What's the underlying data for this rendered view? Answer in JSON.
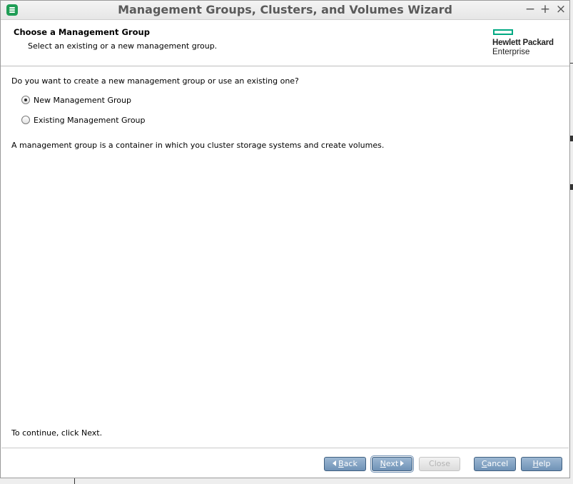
{
  "window": {
    "title": "Management Groups, Clusters, and Volumes Wizard",
    "controls": {
      "minimize": "−",
      "maximize": "+",
      "close": "×"
    }
  },
  "header": {
    "title": "Choose a Management Group",
    "subtitle": "Select an existing or a new management group.",
    "logo": {
      "name": "Hewlett Packard",
      "sub": "Enterprise",
      "brand_color": "#01a982"
    }
  },
  "body": {
    "question": "Do you want to create a new management group or use an existing one?",
    "options": [
      {
        "label": "New Management Group",
        "selected": true
      },
      {
        "label": "Existing Management Group",
        "selected": false
      }
    ],
    "description": "A management group is a container in which you cluster storage systems and create volumes.",
    "continue_hint": "To continue, click Next."
  },
  "footer": {
    "back": {
      "mnemonic": "B",
      "rest": "ack",
      "enabled": true
    },
    "next": {
      "mnemonic": "N",
      "rest": "ext",
      "enabled": true,
      "focused": true
    },
    "close": {
      "label": "Close",
      "enabled": false
    },
    "cancel": {
      "mnemonic": "C",
      "rest": "ancel",
      "enabled": true
    },
    "help": {
      "mnemonic": "H",
      "rest": "elp",
      "enabled": true
    }
  },
  "colors": {
    "button_top": "#9db8d3",
    "button_bottom": "#6f92b6",
    "title_text": "#5a5a5a",
    "app_icon": "#1f9d55"
  },
  "icons": {
    "app": "storage-app-icon",
    "back_arrow": "arrow-left-icon",
    "next_arrow": "arrow-right-icon"
  }
}
